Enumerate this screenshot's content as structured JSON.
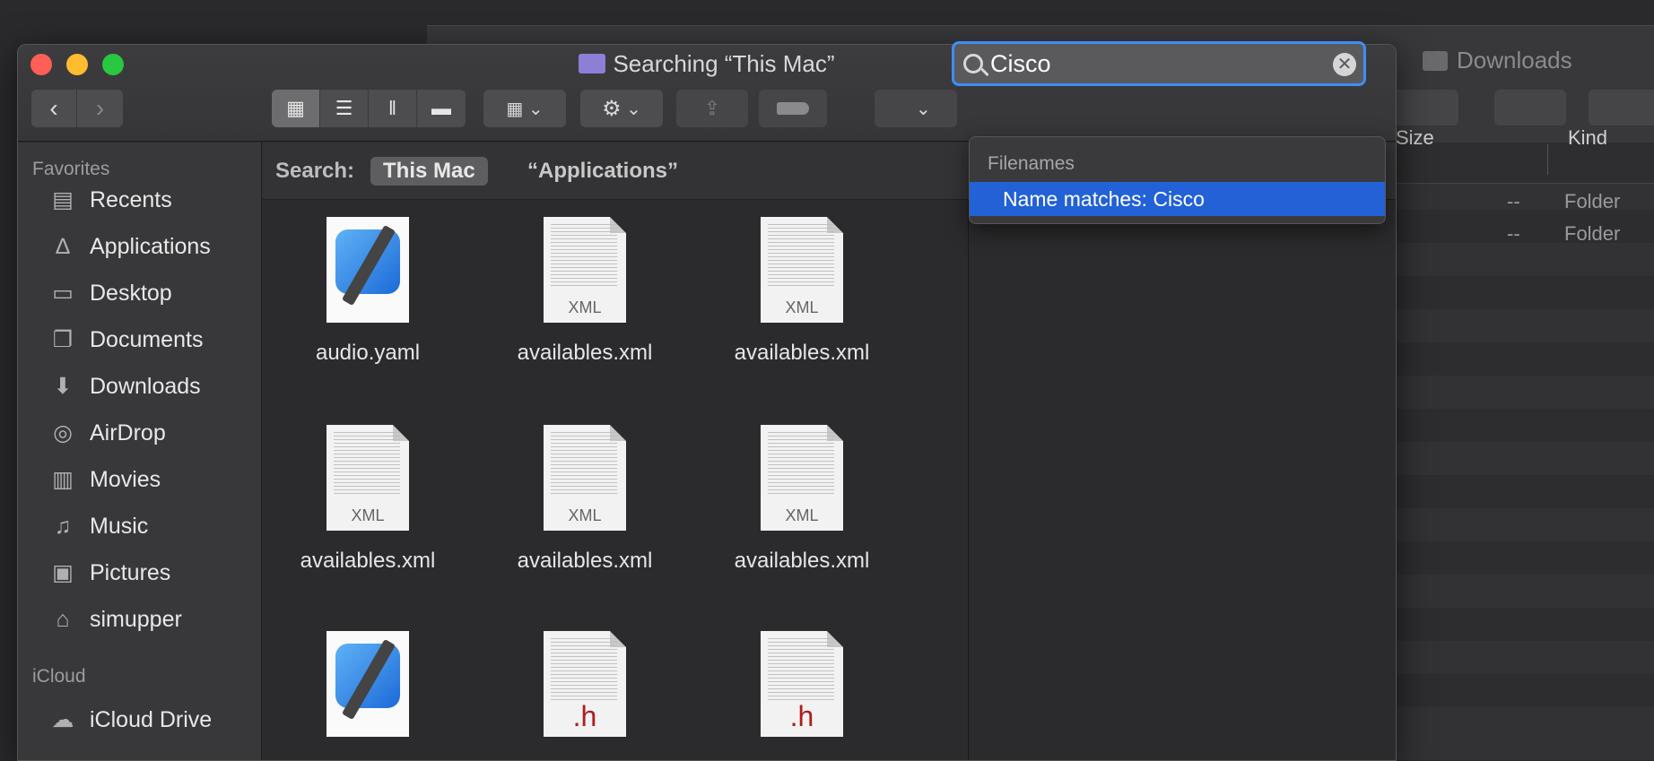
{
  "background_window": {
    "title": "Downloads",
    "columns": {
      "size": "Size",
      "kind": "Kind"
    },
    "rows": [
      {
        "size": "--",
        "kind": "Folder"
      },
      {
        "size": "--",
        "kind": "Folder"
      }
    ]
  },
  "window": {
    "title": "Searching “This Mac”",
    "search_value": "Cisco"
  },
  "sidebar": {
    "favorites_heading": "Favorites",
    "items": [
      {
        "label": "Recents",
        "icon": "recents-icon"
      },
      {
        "label": "Applications",
        "icon": "applications-icon"
      },
      {
        "label": "Desktop",
        "icon": "desktop-icon"
      },
      {
        "label": "Documents",
        "icon": "documents-icon"
      },
      {
        "label": "Downloads",
        "icon": "downloads-icon"
      },
      {
        "label": "AirDrop",
        "icon": "airdrop-icon"
      },
      {
        "label": "Movies",
        "icon": "movies-icon"
      },
      {
        "label": "Music",
        "icon": "music-icon"
      },
      {
        "label": "Pictures",
        "icon": "pictures-icon"
      },
      {
        "label": "simupper",
        "icon": "home-icon"
      }
    ],
    "icloud_heading": "iCloud",
    "icloud_items": [
      {
        "label": "iCloud Drive",
        "icon": "cloud-icon"
      }
    ]
  },
  "scope": {
    "label": "Search:",
    "selected": "This Mac",
    "other": "“Applications”"
  },
  "files": [
    {
      "name": "audio.yaml",
      "kind": "app"
    },
    {
      "name": "availables.xml",
      "kind": "xml",
      "ext": "XML"
    },
    {
      "name": "availables.xml",
      "kind": "xml",
      "ext": "XML"
    },
    {
      "name": "availables.xml",
      "kind": "xml",
      "ext": "XML"
    },
    {
      "name": "availables.xml",
      "kind": "xml",
      "ext": "XML"
    },
    {
      "name": "availables.xml",
      "kind": "xml",
      "ext": "XML"
    },
    {
      "name": "",
      "kind": "app"
    },
    {
      "name": "",
      "kind": "h",
      "ext": ".h"
    },
    {
      "name": "",
      "kind": "h",
      "ext": ".h"
    }
  ],
  "dropdown": {
    "section": "Filenames",
    "item": "Name matches: Cisco"
  }
}
